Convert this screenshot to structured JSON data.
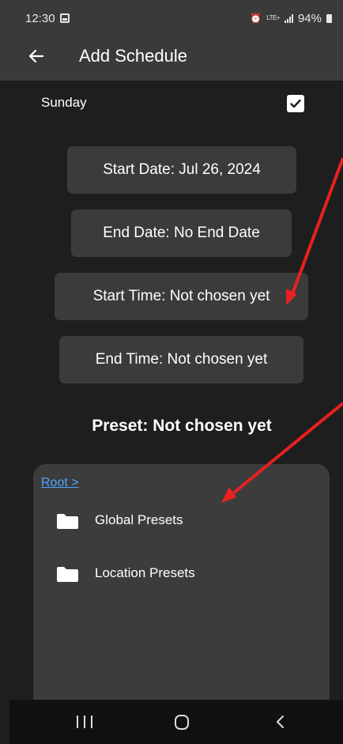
{
  "status_bar": {
    "time": "12:30",
    "lte": "LTE+",
    "battery": "94%"
  },
  "app_bar": {
    "title": "Add Schedule"
  },
  "day": {
    "label": "Sunday",
    "checked": true
  },
  "buttons": {
    "start_date": "Start Date: Jul 26, 2024",
    "end_date": "End Date: No End Date",
    "start_time": "Start Time: Not chosen yet",
    "end_time": "End Time: Not chosen yet"
  },
  "preset": {
    "label": "Preset: Not chosen yet"
  },
  "browser": {
    "breadcrumb": "Root >",
    "folders": [
      {
        "label": "Global Presets",
        "icon": "folder-icon"
      },
      {
        "label": "Location Presets",
        "icon": "folder-icon"
      }
    ]
  },
  "colors": {
    "bar_bg": "#3a3a3a",
    "screen_bg": "#1e1e1e",
    "button_bg": "#3b3b3b",
    "link": "#4fa3ff",
    "annotation_arrow": "#e82020"
  }
}
